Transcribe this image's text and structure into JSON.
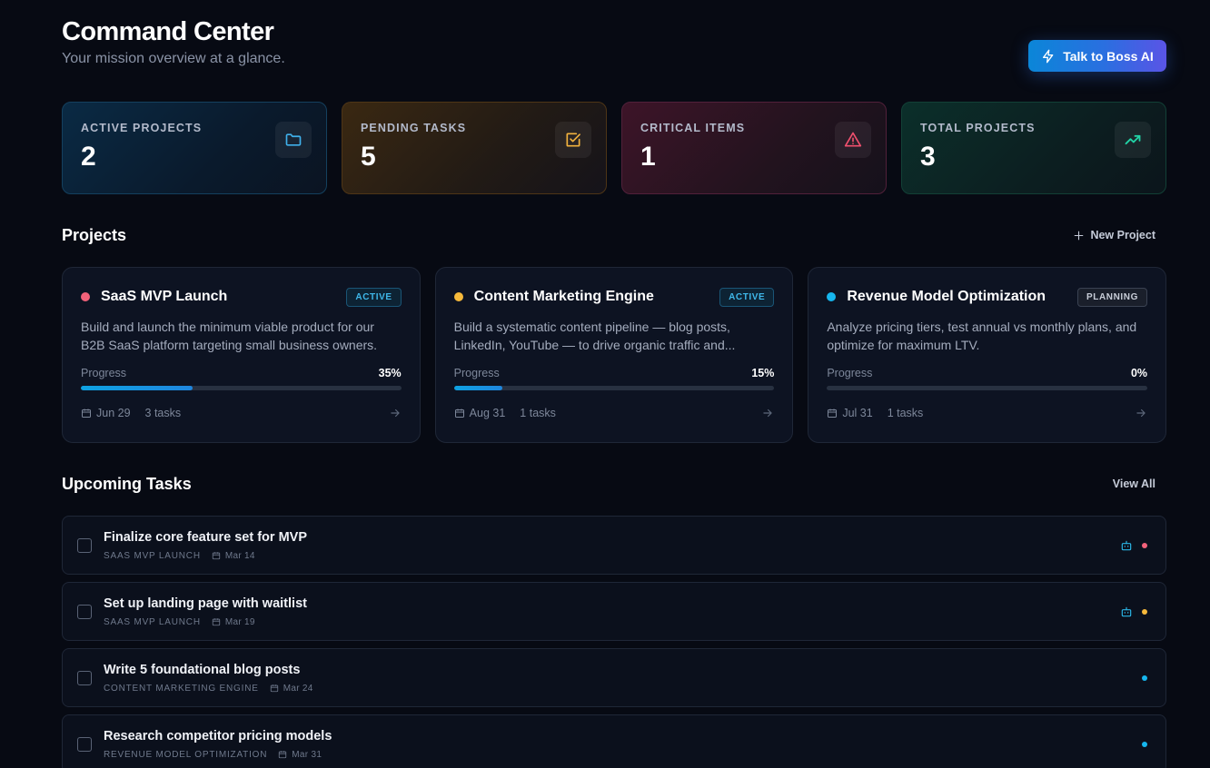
{
  "header": {
    "title": "Command Center",
    "subtitle": "Your mission overview at a glance.",
    "boss_button": "Talk to Boss AI"
  },
  "stats": [
    {
      "label": "ACTIVE PROJECTS",
      "value": "2",
      "icon": "folder-icon",
      "color": "#3fb0ea"
    },
    {
      "label": "PENDING TASKS",
      "value": "5",
      "icon": "checkbox-icon",
      "color": "#f2b23e"
    },
    {
      "label": "CRITICAL ITEMS",
      "value": "1",
      "icon": "alert-triangle-icon",
      "color": "#f0506e"
    },
    {
      "label": "TOTAL PROJECTS",
      "value": "3",
      "icon": "trending-up-icon",
      "color": "#22d3a6"
    }
  ],
  "projects_section": {
    "title": "Projects",
    "new_label": "New Project",
    "items": [
      {
        "name": "SaaS MVP Launch",
        "dot_color": "#f2627a",
        "status": "ACTIVE",
        "description": "Build and launch the minimum viable product for our B2B SaaS platform targeting small business owners.",
        "progress_label": "Progress",
        "progress_text": "35%",
        "progress": 35,
        "date": "Jun 29",
        "tasks": "3 tasks"
      },
      {
        "name": "Content Marketing Engine",
        "dot_color": "#f6b93b",
        "status": "ACTIVE",
        "description": "Build a systematic content pipeline — blog posts, LinkedIn, YouTube — to drive organic traffic and...",
        "progress_label": "Progress",
        "progress_text": "15%",
        "progress": 15,
        "date": "Aug 31",
        "tasks": "1 tasks"
      },
      {
        "name": "Revenue Model Optimization",
        "dot_color": "#16b6ee",
        "status": "PLANNING",
        "description": "Analyze pricing tiers, test annual vs monthly plans, and optimize for maximum LTV.",
        "progress_label": "Progress",
        "progress_text": "0%",
        "progress": 0,
        "date": "Jul 31",
        "tasks": "1 tasks"
      }
    ]
  },
  "tasks_section": {
    "title": "Upcoming Tasks",
    "view_all": "View All",
    "items": [
      {
        "title": "Finalize core feature set for MVP",
        "project": "SAAS MVP LAUNCH",
        "date": "Mar 14",
        "ai": true,
        "dot_color": "#f2627a"
      },
      {
        "title": "Set up landing page with waitlist",
        "project": "SAAS MVP LAUNCH",
        "date": "Mar 19",
        "ai": true,
        "dot_color": "#f6b93b"
      },
      {
        "title": "Write 5 foundational blog posts",
        "project": "CONTENT MARKETING ENGINE",
        "date": "Mar 24",
        "ai": false,
        "dot_color": "#16b6ee"
      },
      {
        "title": "Research competitor pricing models",
        "project": "REVENUE MODEL OPTIMIZATION",
        "date": "Mar 31",
        "ai": false,
        "dot_color": "#16b6ee"
      }
    ]
  }
}
